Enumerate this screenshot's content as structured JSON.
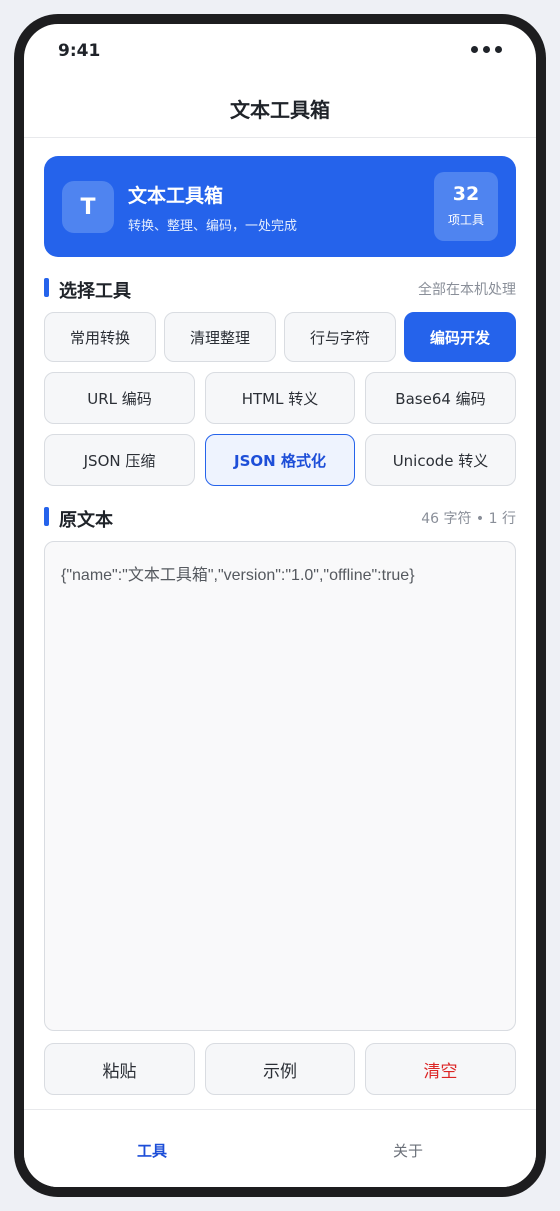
{
  "status": {
    "time": "9:41"
  },
  "header": {
    "title": "文本工具箱"
  },
  "hero": {
    "logo": "T",
    "title": "文本工具箱",
    "subtitle": "转换、整理、编码，一处完成",
    "count": "32",
    "count_unit": "项工具"
  },
  "tools_section": {
    "title": "选择工具",
    "note": "全部在本机处理"
  },
  "categories": [
    "常用转换",
    "清理整理",
    "行与字符",
    "编码开发"
  ],
  "active_category": "编码开发",
  "tools": [
    "URL 编码",
    "HTML 转义",
    "Base64 编码",
    "JSON 压缩",
    "JSON 格式化",
    "Unicode 转义"
  ],
  "active_tool": "JSON 格式化",
  "source_section": {
    "title": "原文本",
    "stats": "46 字符 • 1 行"
  },
  "source_text": "{\"name\":\"文本工具箱\",\"version\":\"1.0\",\"offline\":true}",
  "actions": {
    "paste": "粘贴",
    "example": "示例",
    "clear": "清空"
  },
  "tabbar": {
    "tools": "工具",
    "about": "关于"
  },
  "colors": {
    "accent": "#2563eb",
    "danger": "#dc2626"
  }
}
